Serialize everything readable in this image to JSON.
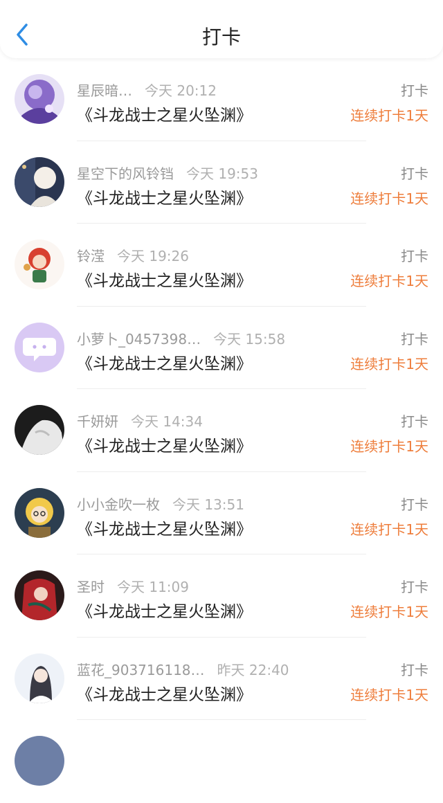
{
  "header": {
    "title": "打卡"
  },
  "book_title": "《斗龙战士之星火坠渊》",
  "action_label": "打卡",
  "streak_label": "连续打卡1天",
  "colors": {
    "accent": "#ee7d3b",
    "back": "#2f8de4"
  },
  "items": [
    {
      "name": "星辰暗…",
      "time": "今天 20:12",
      "avatar": "purple-anime"
    },
    {
      "name": "星空下的风铃铛",
      "time": "今天 19:53",
      "avatar": "night-anime"
    },
    {
      "name": "铃滢",
      "time": "今天 19:26",
      "avatar": "red-chibi"
    },
    {
      "name": "小萝卜_0457398…",
      "time": "今天 15:58",
      "avatar": "default-chat"
    },
    {
      "name": "千妍妍",
      "time": "今天 14:34",
      "avatar": "white-cloth"
    },
    {
      "name": "小小金吹一枚",
      "time": "今天 13:51",
      "avatar": "blonde-anime"
    },
    {
      "name": "圣时",
      "time": "今天 11:09",
      "avatar": "dark-red"
    },
    {
      "name": "蓝花_903716118…",
      "time": "昨天 22:40",
      "avatar": "girl-light"
    }
  ]
}
